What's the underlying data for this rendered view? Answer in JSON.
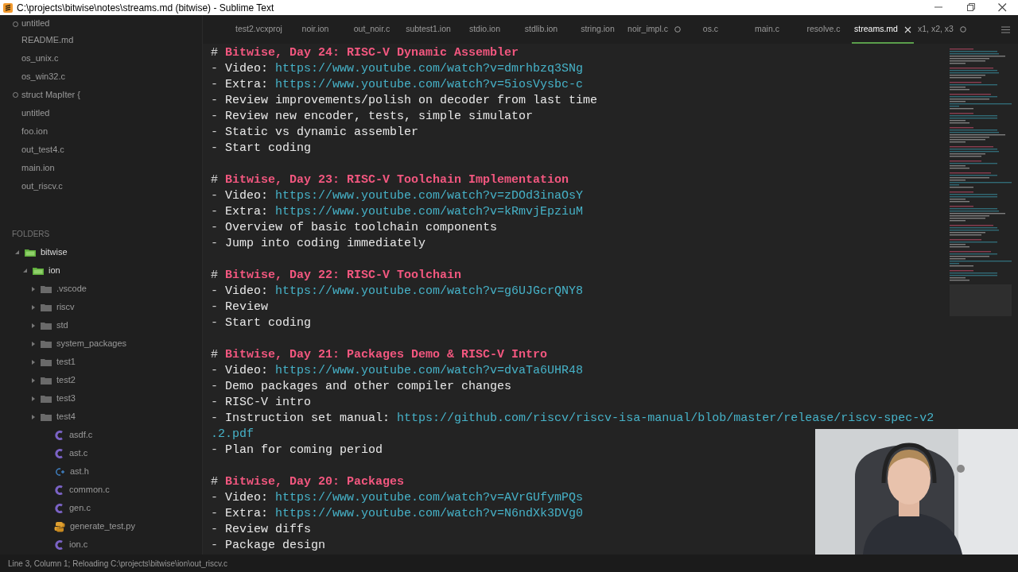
{
  "window": {
    "title": "C:\\projects\\bitwise\\notes\\streams.md (bitwise) - Sublime Text"
  },
  "sidebar": {
    "open_files": [
      {
        "label": "untitled",
        "dirty": true
      },
      {
        "label": "README.md",
        "dirty": false
      },
      {
        "label": "os_unix.c",
        "dirty": false
      },
      {
        "label": "os_win32.c",
        "dirty": false
      },
      {
        "label": "struct MapIter {",
        "dirty": true
      },
      {
        "label": "untitled",
        "dirty": false
      },
      {
        "label": "foo.ion",
        "dirty": false
      },
      {
        "label": "out_test4.c",
        "dirty": false
      },
      {
        "label": "main.ion",
        "dirty": false
      },
      {
        "label": "out_riscv.c",
        "dirty": false
      }
    ],
    "folders_heading": "FOLDERS",
    "tree": [
      {
        "kind": "folder",
        "label": "bitwise",
        "expanded": true,
        "children": [
          {
            "kind": "folder",
            "label": "ion",
            "expanded": true,
            "children": [
              {
                "kind": "folder",
                "label": ".vscode",
                "expanded": false
              },
              {
                "kind": "folder",
                "label": "riscv",
                "expanded": false
              },
              {
                "kind": "folder",
                "label": "std",
                "expanded": false
              },
              {
                "kind": "folder",
                "label": "system_packages",
                "expanded": false
              },
              {
                "kind": "folder",
                "label": "test1",
                "expanded": false
              },
              {
                "kind": "folder",
                "label": "test2",
                "expanded": false
              },
              {
                "kind": "folder",
                "label": "test3",
                "expanded": false
              },
              {
                "kind": "folder",
                "label": "test4",
                "expanded": false
              },
              {
                "kind": "c",
                "label": "asdf.c"
              },
              {
                "kind": "c",
                "label": "ast.c"
              },
              {
                "kind": "h",
                "label": "ast.h"
              },
              {
                "kind": "c",
                "label": "common.c"
              },
              {
                "kind": "c",
                "label": "gen.c"
              },
              {
                "kind": "py",
                "label": "generate_test.py"
              },
              {
                "kind": "c",
                "label": "ion.c"
              }
            ]
          }
        ]
      }
    ]
  },
  "tabs": [
    {
      "label": "test2.vcxproj",
      "selected": false,
      "dirty": false
    },
    {
      "label": "noir.ion",
      "selected": false,
      "dirty": false
    },
    {
      "label": "out_noir.c",
      "selected": false,
      "dirty": false
    },
    {
      "label": "subtest1.ion",
      "selected": false,
      "dirty": false
    },
    {
      "label": "stdio.ion",
      "selected": false,
      "dirty": false
    },
    {
      "label": "stdlib.ion",
      "selected": false,
      "dirty": false
    },
    {
      "label": "string.ion",
      "selected": false,
      "dirty": false
    },
    {
      "label": "noir_impl.c",
      "selected": false,
      "dirty": true
    },
    {
      "label": "os.c",
      "selected": false,
      "dirty": false
    },
    {
      "label": "main.c",
      "selected": false,
      "dirty": false
    },
    {
      "label": "resolve.c",
      "selected": false,
      "dirty": false
    },
    {
      "label": "streams.md",
      "selected": true,
      "dirty": false
    },
    {
      "label": "x1, x2, x3",
      "selected": false,
      "dirty": true
    }
  ],
  "editor": {
    "sections": [
      {
        "marker": "#",
        "heading": "Bitwise, Day 24: RISC-V Dynamic Assembler",
        "items": [
          {
            "marker": "-",
            "text": "Video: ",
            "link": "https://www.youtube.com/watch?v=dmrhbzq3SNg"
          },
          {
            "marker": "-",
            "text": "Extra: ",
            "link": "https://www.youtube.com/watch?v=5iosVysbc-c"
          },
          {
            "marker": "-",
            "text": "Review improvements/polish on decoder from last time"
          },
          {
            "marker": "-",
            "text": "Review new encoder, tests, simple simulator"
          },
          {
            "marker": "-",
            "text": "Static vs dynamic assembler"
          },
          {
            "marker": "-",
            "text": "Start coding"
          }
        ]
      },
      {
        "marker": "#",
        "heading": "Bitwise, Day 23: RISC-V Toolchain Implementation",
        "items": [
          {
            "marker": "-",
            "text": "Video: ",
            "link": "https://www.youtube.com/watch?v=zDOd3inaOsY"
          },
          {
            "marker": "-",
            "text": "Extra: ",
            "link": "https://www.youtube.com/watch?v=kRmvjEpziuM"
          },
          {
            "marker": "-",
            "text": "Overview of basic toolchain components"
          },
          {
            "marker": "-",
            "text": "Jump into coding immediately"
          }
        ]
      },
      {
        "marker": "#",
        "heading": "Bitwise, Day 22: RISC-V Toolchain",
        "items": [
          {
            "marker": "-",
            "text": "Video: ",
            "link": "https://www.youtube.com/watch?v=g6UJGcrQNY8"
          },
          {
            "marker": "-",
            "text": "Review"
          },
          {
            "marker": "-",
            "text": "Start coding"
          }
        ]
      },
      {
        "marker": "#",
        "heading": "Bitwise, Day 21: Packages Demo & RISC-V Intro",
        "items": [
          {
            "marker": "-",
            "text": "Video: ",
            "link": "https://www.youtube.com/watch?v=dvaTa6UHR48"
          },
          {
            "marker": "-",
            "text": "Demo packages and other compiler changes"
          },
          {
            "marker": "-",
            "text": "RISC-V intro"
          },
          {
            "marker": "-",
            "text": "Instruction set manual: ",
            "link": "https://github.com/riscv/riscv-isa-manual/blob/master/release/riscv-spec-v2",
            "link_wrap": ".2.pdf"
          },
          {
            "marker": "-",
            "text": "Plan for coming period"
          }
        ]
      },
      {
        "marker": "#",
        "heading": "Bitwise, Day 20: Packages",
        "items": [
          {
            "marker": "-",
            "text": "Video: ",
            "link": "https://www.youtube.com/watch?v=AVrGUfymPQs"
          },
          {
            "marker": "-",
            "text": "Extra: ",
            "link": "https://www.youtube.com/watch?v=N6ndXk3DVg0"
          },
          {
            "marker": "-",
            "text": "Review diffs"
          },
          {
            "marker": "-",
            "text": "Package design"
          }
        ]
      }
    ]
  },
  "status_bar": "Line 3, Column 1; Reloading C:\\projects\\bitwise\\ion\\out_riscv.c"
}
